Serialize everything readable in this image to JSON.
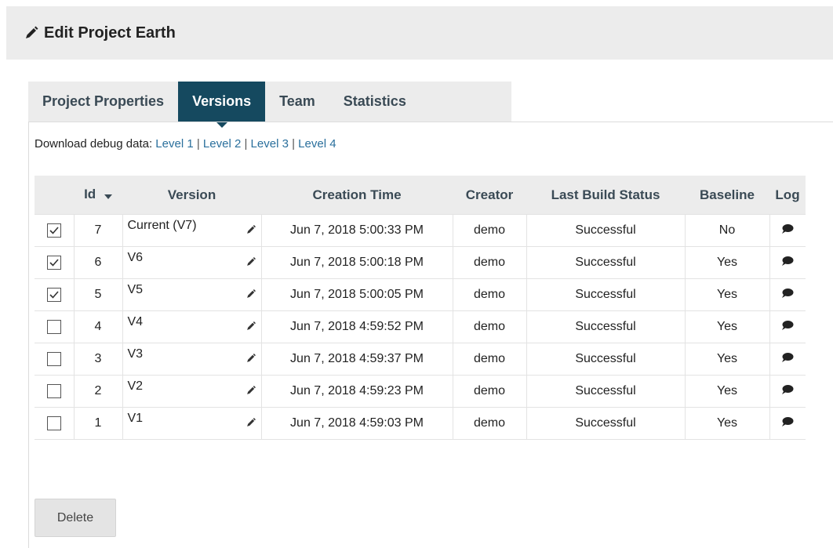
{
  "header": {
    "title": "Edit Project Earth"
  },
  "tabs": [
    {
      "label": "Project Properties",
      "active": false
    },
    {
      "label": "Versions",
      "active": true
    },
    {
      "label": "Team",
      "active": false
    },
    {
      "label": "Statistics",
      "active": false
    }
  ],
  "debug": {
    "prefix": "Download debug data:",
    "links": [
      "Level 1",
      "Level 2",
      "Level 3",
      "Level 4"
    ],
    "separator": "|"
  },
  "table": {
    "columns": [
      "",
      "Id",
      "Version",
      "Creation Time",
      "Creator",
      "Last Build Status",
      "Baseline",
      "Log"
    ],
    "rows": [
      {
        "checked": true,
        "id": "7",
        "version": "Current (V7)",
        "time": "Jun 7, 2018 5:00:33 PM",
        "creator": "demo",
        "status": "Successful",
        "baseline": "No"
      },
      {
        "checked": true,
        "id": "6",
        "version": "V6",
        "time": "Jun 7, 2018 5:00:18 PM",
        "creator": "demo",
        "status": "Successful",
        "baseline": "Yes"
      },
      {
        "checked": true,
        "id": "5",
        "version": "V5",
        "time": "Jun 7, 2018 5:00:05 PM",
        "creator": "demo",
        "status": "Successful",
        "baseline": "Yes"
      },
      {
        "checked": false,
        "id": "4",
        "version": "V4",
        "time": "Jun 7, 2018 4:59:52 PM",
        "creator": "demo",
        "status": "Successful",
        "baseline": "Yes"
      },
      {
        "checked": false,
        "id": "3",
        "version": "V3",
        "time": "Jun 7, 2018 4:59:37 PM",
        "creator": "demo",
        "status": "Successful",
        "baseline": "Yes"
      },
      {
        "checked": false,
        "id": "2",
        "version": "V2",
        "time": "Jun 7, 2018 4:59:23 PM",
        "creator": "demo",
        "status": "Successful",
        "baseline": "Yes"
      },
      {
        "checked": false,
        "id": "1",
        "version": "V1",
        "time": "Jun 7, 2018 4:59:03 PM",
        "creator": "demo",
        "status": "Successful",
        "baseline": "Yes"
      }
    ]
  },
  "actions": {
    "delete_label": "Delete"
  },
  "icons": {
    "title": "pencil-icon",
    "sort": "sort-down-icon",
    "edit": "pencil-icon",
    "log": "comment-icon",
    "check": "checkmark-icon"
  },
  "colors": {
    "active_tab": "#15495f",
    "link": "#2a6f9c",
    "header_bg": "#ececec"
  }
}
